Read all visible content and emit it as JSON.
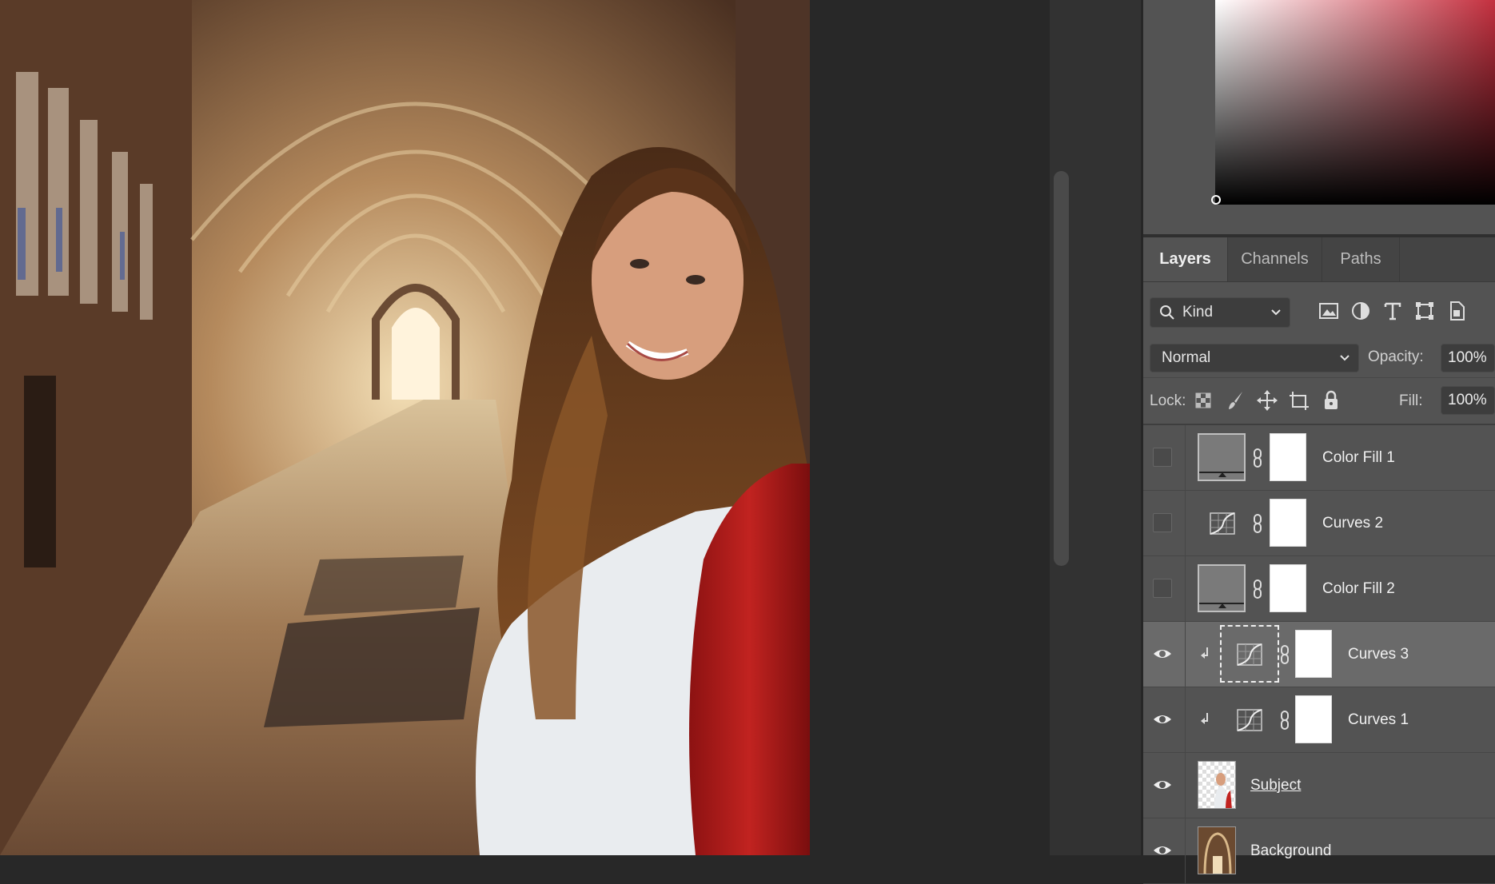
{
  "canvas": {
    "image_name": "cloister-portrait-composite"
  },
  "layers_panel": {
    "tabs": [
      {
        "label": "Layers",
        "active": true
      },
      {
        "label": "Channels",
        "active": false
      },
      {
        "label": "Paths",
        "active": false
      }
    ],
    "filter": {
      "label": "Kind",
      "icons": [
        "image-filter-icon",
        "adjustment-filter-icon",
        "type-filter-icon",
        "shape-filter-icon",
        "smart-object-filter-icon"
      ]
    },
    "blend_mode": "Normal",
    "opacity_label": "Opacity:",
    "opacity_value": "100%",
    "lock_label": "Lock:",
    "lock_icons": [
      "lock-transparent-pixels-icon",
      "lock-image-pixels-icon",
      "lock-position-icon",
      "lock-artboard-icon",
      "lock-all-icon"
    ],
    "fill_label": "Fill:",
    "fill_value": "100%",
    "layers": [
      {
        "name": "Color Fill 1",
        "visible": false,
        "type": "color-fill"
      },
      {
        "name": "Curves 2",
        "visible": false,
        "type": "curves"
      },
      {
        "name": "Color Fill 2",
        "visible": false,
        "type": "color-fill"
      },
      {
        "name": "Curves 3",
        "visible": true,
        "type": "curves",
        "clipped": true,
        "selected": true
      },
      {
        "name": "Curves 1",
        "visible": true,
        "type": "curves",
        "clipped": true
      },
      {
        "name": "Subject",
        "visible": true,
        "type": "pixel"
      },
      {
        "name": "Background",
        "visible": true,
        "type": "pixel"
      }
    ]
  },
  "colors": {
    "panel_bg": "#535353",
    "selected_row": "#6a6a6a",
    "picker_hue": "#c4303f"
  }
}
